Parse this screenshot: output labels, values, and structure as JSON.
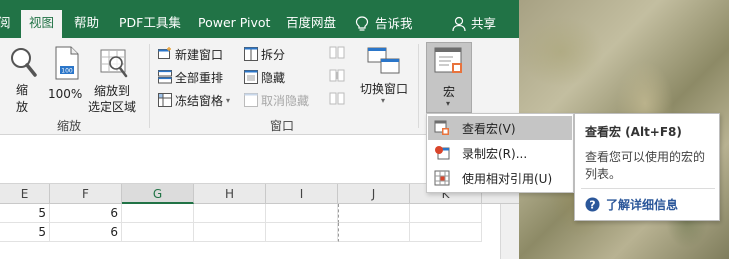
{
  "tabs": [
    {
      "label": "阅",
      "active": false
    },
    {
      "label": "视图",
      "active": true
    },
    {
      "label": "帮助",
      "active": false
    },
    {
      "label": "PDF工具集",
      "active": false
    },
    {
      "label": "Power Pivot",
      "active": false
    },
    {
      "label": "百度网盘",
      "active": false
    },
    {
      "label": "告诉我",
      "active": false
    },
    {
      "label": "共享",
      "active": false
    }
  ],
  "ribbon": {
    "zoom_group": {
      "zoom_label_1": "缩",
      "zoom_label_2": "放",
      "hundred_label": "100%",
      "fit_label_1": "缩放到",
      "fit_label_2": "选定区域",
      "group_label": "缩放"
    },
    "window_group": {
      "new_window": "新建窗口",
      "arrange_all": "全部重排",
      "freeze_panes": "冻结窗格",
      "split": "拆分",
      "hide": "隐藏",
      "unhide": "取消隐藏",
      "switch_windows": "切换窗口",
      "group_label": "窗口"
    },
    "macro_group": {
      "macro_label": "宏"
    }
  },
  "grid": {
    "columns": [
      "E",
      "F",
      "G",
      "H",
      "I",
      "J",
      "K"
    ],
    "selected_column": "G",
    "rows": [
      [
        "5",
        "6",
        "",
        "",
        "",
        "",
        ""
      ],
      [
        "5",
        "6",
        "",
        "",
        "",
        "",
        ""
      ]
    ]
  },
  "macro_menu": {
    "items": [
      {
        "label": "查看宏(V)"
      },
      {
        "label": "录制宏(R)..."
      },
      {
        "label": "使用相对引用(U)"
      }
    ]
  },
  "tooltip": {
    "title": "查看宏 (Alt+F8)",
    "description": "查看您可以使用的宏的列表。",
    "link": "了解详细信息"
  },
  "colors": {
    "accent": "#217346",
    "link": "#2b579a"
  }
}
